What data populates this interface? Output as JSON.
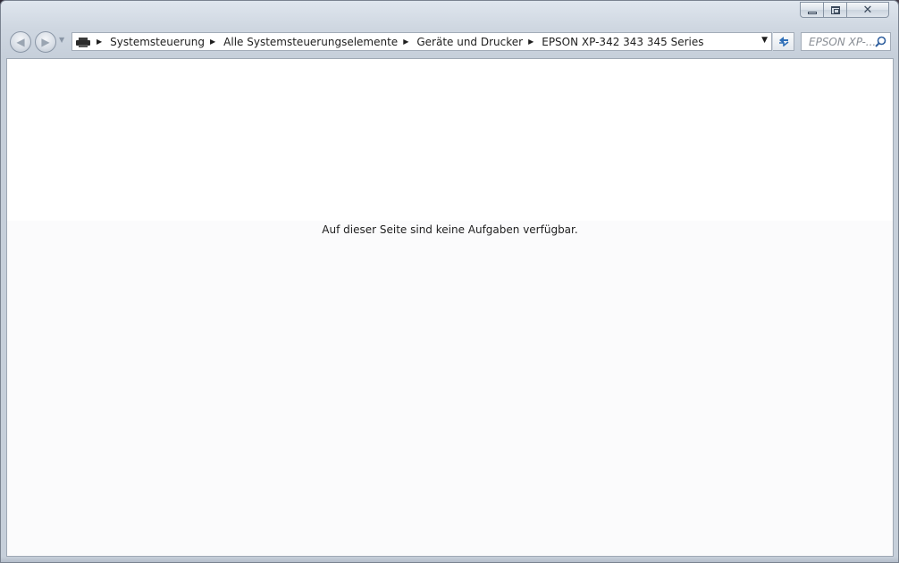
{
  "window": {
    "controls": {
      "minimize_icon": "minimize-icon",
      "maximize_icon": "restore-icon",
      "close_icon": "close-icon"
    }
  },
  "navigation": {
    "back_icon": "back-arrow-icon",
    "forward_icon": "forward-arrow-icon",
    "recent_icon": "chevron-down-icon"
  },
  "address": {
    "icon": "printer-icon",
    "breadcrumbs": [
      "Systemsteuerung",
      "Alle Systemsteuerungselemente",
      "Geräte und Drucker",
      "EPSON XP-342 343 345 Series"
    ]
  },
  "search": {
    "placeholder": "EPSON XP-..."
  },
  "content": {
    "message": "Auf dieser Seite sind keine Aufgaben verfügbar."
  },
  "colors": {
    "chrome": "#cfd7e1",
    "content_background": "#ffffff",
    "lower_background": "#fbfbfc",
    "text": "#1e1e1e"
  }
}
